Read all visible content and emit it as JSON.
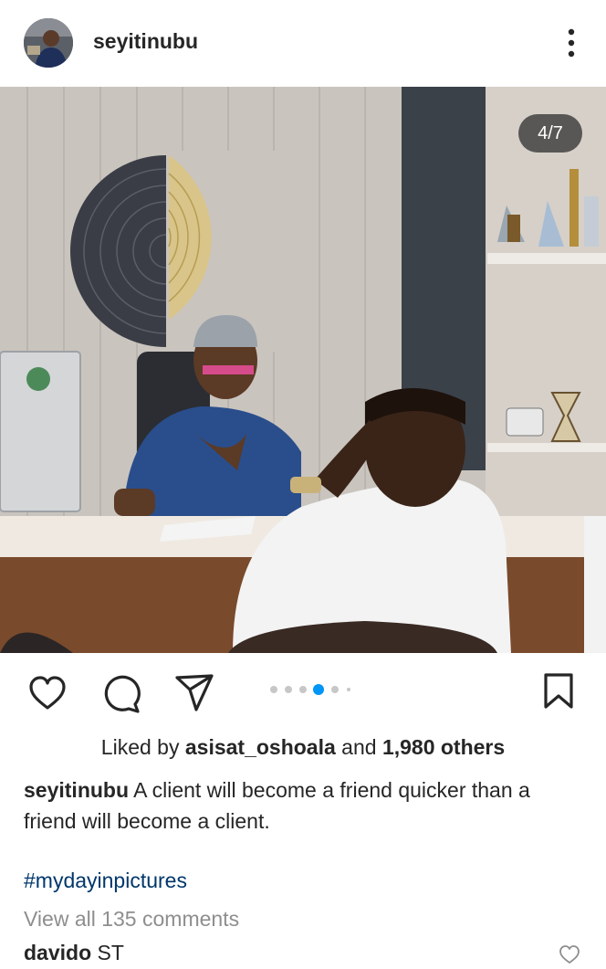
{
  "post": {
    "username": "seyitinubu",
    "image_counter": "4/7",
    "carousel": {
      "total": 6,
      "active_index": 3
    },
    "likes": {
      "prefix": "Liked by",
      "liker": "asisat_oshoala",
      "joiner": "and",
      "others": "1,980 others"
    },
    "caption": {
      "username": "seyitinubu",
      "text": "A client will become a friend quicker than a friend will become a client."
    },
    "hashtag": "#mydayinpictures",
    "view_comments": "View all 135 comments",
    "comments": [
      {
        "username": "davido",
        "text": "ST"
      }
    ]
  },
  "icons": {
    "more": "more-vertical-icon",
    "like": "heart-icon",
    "comment": "comment-bubble-icon",
    "share": "send-icon",
    "save": "bookmark-icon"
  },
  "colors": {
    "text": "#262626",
    "link": "#00376b",
    "muted": "#8e8e8e",
    "active_dot": "#0095f6",
    "inactive_dot": "#c7c7c7"
  }
}
